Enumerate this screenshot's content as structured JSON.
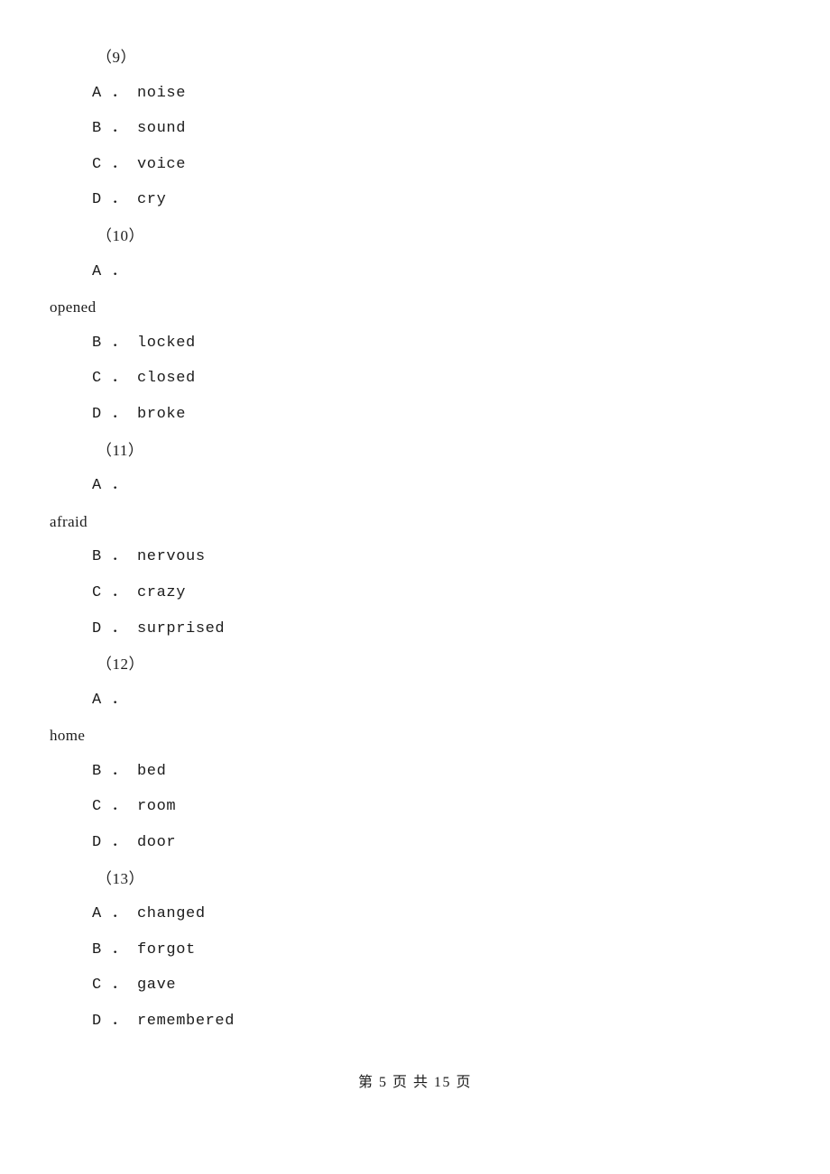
{
  "document": {
    "page_background": "#ffffff",
    "text_color": "#1c1c1c",
    "lines": [
      {
        "kind": "question-number",
        "text": "（9）"
      },
      {
        "kind": "option",
        "text": "A ． noise"
      },
      {
        "kind": "option",
        "text": "B ． sound"
      },
      {
        "kind": "option",
        "text": "C ． voice"
      },
      {
        "kind": "option",
        "text": "D ． cry"
      },
      {
        "kind": "question-number",
        "text": "（10）"
      },
      {
        "kind": "option",
        "text": "A ．"
      },
      {
        "kind": "wrapped-word",
        "text": "opened"
      },
      {
        "kind": "option",
        "text": "B ． locked"
      },
      {
        "kind": "option",
        "text": "C ． closed"
      },
      {
        "kind": "option",
        "text": "D ． broke"
      },
      {
        "kind": "question-number",
        "text": "（11）"
      },
      {
        "kind": "option",
        "text": "A ．"
      },
      {
        "kind": "wrapped-word",
        "text": "afraid"
      },
      {
        "kind": "option",
        "text": "B ． nervous"
      },
      {
        "kind": "option",
        "text": "C ． crazy"
      },
      {
        "kind": "option",
        "text": "D ． surprised"
      },
      {
        "kind": "question-number",
        "text": "（12）"
      },
      {
        "kind": "option",
        "text": "A ．"
      },
      {
        "kind": "wrapped-word",
        "text": "home"
      },
      {
        "kind": "option",
        "text": "B ． bed"
      },
      {
        "kind": "option",
        "text": "C ． room"
      },
      {
        "kind": "option",
        "text": "D ． door"
      },
      {
        "kind": "question-number",
        "text": "（13）"
      },
      {
        "kind": "option",
        "text": "A ． changed"
      },
      {
        "kind": "option",
        "text": "B ． forgot"
      },
      {
        "kind": "option",
        "text": "C ． gave"
      },
      {
        "kind": "option",
        "text": "D ． remembered"
      }
    ],
    "footer": {
      "text": "第 5 页 共 15 页",
      "current_page": "5",
      "total_pages": "15"
    }
  }
}
